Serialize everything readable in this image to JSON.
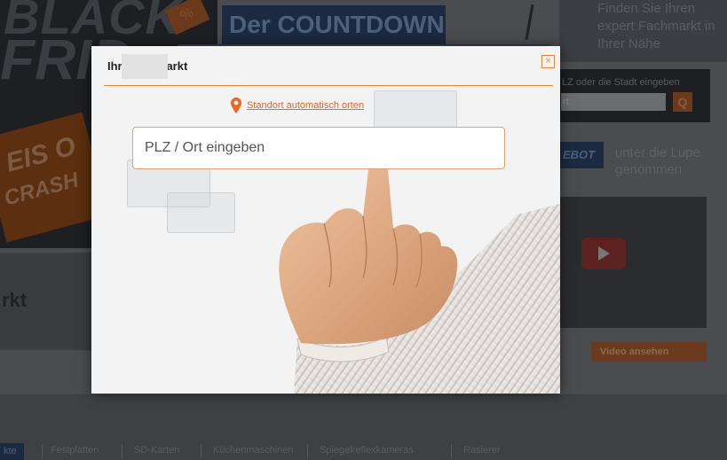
{
  "background": {
    "banner_black": "BLACK",
    "banner_friday": "FRID",
    "banner_tag": "%",
    "banner_crash_1": "EIS O",
    "banner_crash_2": "CRASH",
    "countdown": "Der COUNTDOWN",
    "promo_text": "Finden Sie Ihren expert Fachmarkt in Ihrer Nähe",
    "search_label": "LZ oder die Stadt eingeben",
    "search_value": "rt",
    "search_button": "Q",
    "angebot_label": "EBOT",
    "lupe_text": "unter die Lupe genommen",
    "video_button": "Video ansehen",
    "markt_heading": "rkt",
    "categories": [
      {
        "label": "kte",
        "active": true
      },
      {
        "label": "Festplatten",
        "active": false
      },
      {
        "label": "SD-Karten",
        "active": false
      },
      {
        "label": "Küchenmaschinen",
        "active": false
      },
      {
        "label": "Spiegelreflexkameras",
        "active": false
      },
      {
        "label": "Rasierer",
        "active": false
      }
    ]
  },
  "modal": {
    "title": "Ihr          -Fachmarkt",
    "close_icon": "×",
    "locate_link": "Standort automatisch orten",
    "plz_placeholder": "PLZ / Ort eingeben",
    "plz_value": ""
  },
  "colors": {
    "accent": "#e8833a",
    "link": "#e8662a",
    "brand_blue": "#1b2a40"
  },
  "icons": [
    "pin-icon",
    "close-icon",
    "play-icon",
    "search-icon"
  ]
}
